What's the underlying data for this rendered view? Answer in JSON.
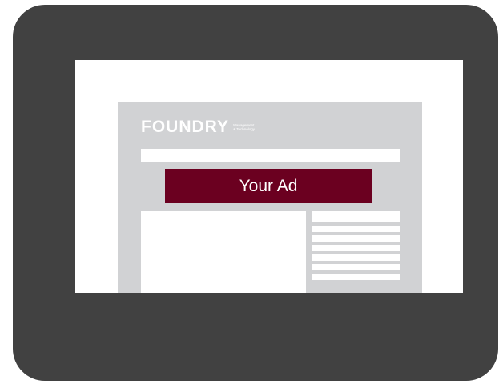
{
  "logo": {
    "wordmark": "FOUNDRY",
    "tagline_line1": "Management",
    "tagline_line2": "& Technology"
  },
  "ad": {
    "label": "Your Ad"
  },
  "colors": {
    "device_frame": "#414141",
    "page_background": "#d1d2d4",
    "ad_background": "#6b0020",
    "screen": "#ffffff"
  }
}
